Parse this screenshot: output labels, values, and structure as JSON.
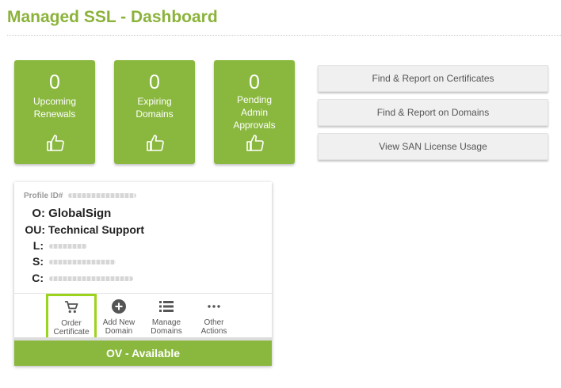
{
  "header": {
    "title": "Managed SSL - Dashboard"
  },
  "tiles": [
    {
      "count": "0",
      "label": "Upcoming Renewals",
      "icon": "thumbs-up-icon"
    },
    {
      "count": "0",
      "label": "Expiring Domains",
      "icon": "thumbs-up-icon"
    },
    {
      "count": "0",
      "label": "Pending Admin Approvals",
      "icon": "thumbs-up-icon"
    }
  ],
  "reports": {
    "certificates": "Find & Report on Certificates",
    "domains": "Find & Report on Domains",
    "san": "View SAN License Usage"
  },
  "profile": {
    "id_label": "Profile ID#",
    "o_key": "O:",
    "o_value": "GlobalSign",
    "ou_key": "OU:",
    "ou_value": "Technical Support",
    "l_key": "L:",
    "s_key": "S:",
    "c_key": "C:",
    "actions": [
      {
        "label": "Order Certificate",
        "icon": "cart-icon"
      },
      {
        "label": "Add New Domain",
        "icon": "plus-circle-icon"
      },
      {
        "label": "Manage Domains",
        "icon": "list-icon"
      },
      {
        "label": "Other Actions",
        "icon": "more-icon"
      }
    ],
    "status": "OV - Available"
  },
  "colors": {
    "accent": "#8ab83f",
    "title": "#8bb33a",
    "highlight": "#9bd41d"
  }
}
